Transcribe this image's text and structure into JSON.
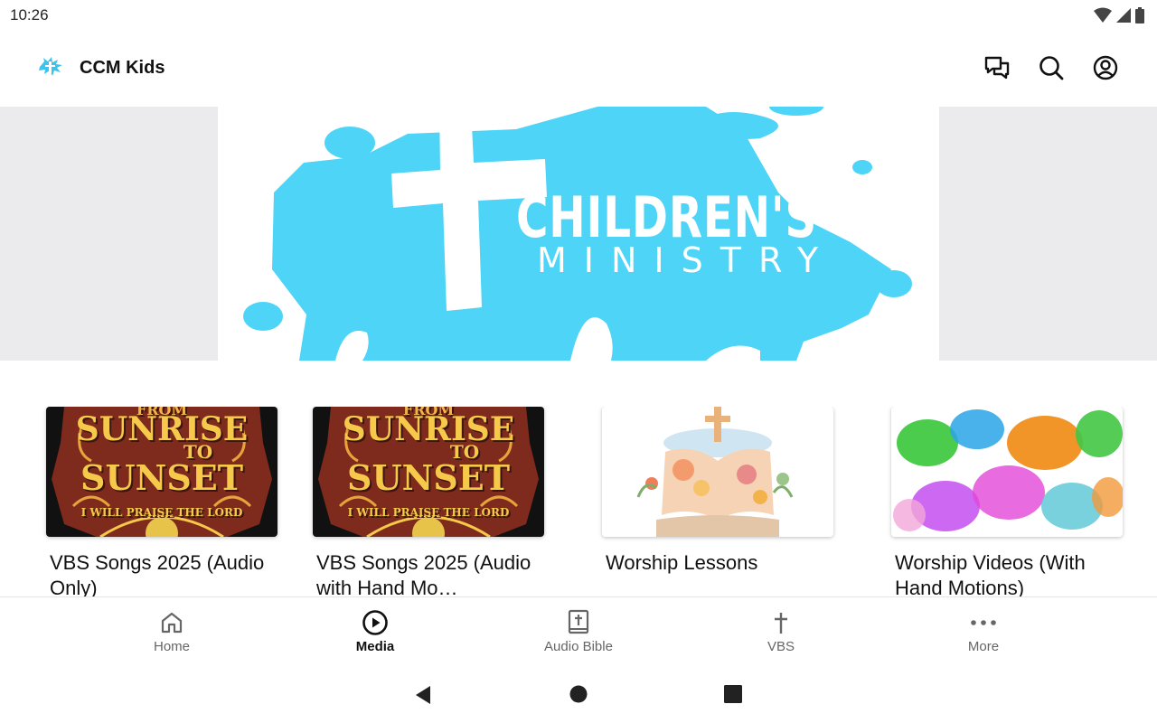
{
  "status_bar": {
    "time": "10:26",
    "icons": [
      "wifi-icon",
      "signal-icon",
      "battery-icon"
    ]
  },
  "app_bar": {
    "title": "CCM Kids",
    "actions": [
      "chat-icon",
      "search-icon",
      "account-icon"
    ]
  },
  "hero": {
    "heading": "CHILDREN'S",
    "subheading": "MINISTRY",
    "colors": {
      "splash": "#4dd4f7",
      "side_fill": "#ebebed"
    }
  },
  "cards": [
    {
      "title": "VBS Songs 2025 (Audio Only)",
      "thumb": {
        "top": "SUNRISE",
        "mid": "TO",
        "bottom": "SUNSET",
        "arc": "I WILL PRAISE THE LORD",
        "banner": "FROM"
      }
    },
    {
      "title": "VBS Songs 2025 (Audio with Hand Mo…",
      "thumb": {
        "top": "SUNRISE",
        "mid": "TO",
        "bottom": "SUNSET",
        "arc": "I WILL PRAISE THE LORD",
        "banner": "FROM"
      }
    },
    {
      "title": "Worship Lessons"
    },
    {
      "title": "Worship Videos (With Hand Motions)"
    }
  ],
  "bottom_nav": {
    "items": [
      {
        "label": "Home",
        "icon": "home-icon",
        "active": false
      },
      {
        "label": "Media",
        "icon": "play-circle-icon",
        "active": true
      },
      {
        "label": "Audio Bible",
        "icon": "bible-icon",
        "active": false
      },
      {
        "label": "VBS",
        "icon": "cross-icon",
        "active": false
      },
      {
        "label": "More",
        "icon": "more-dots-icon",
        "active": false
      }
    ]
  },
  "system_nav": [
    "back-icon",
    "home-circle-icon",
    "recents-icon"
  ]
}
